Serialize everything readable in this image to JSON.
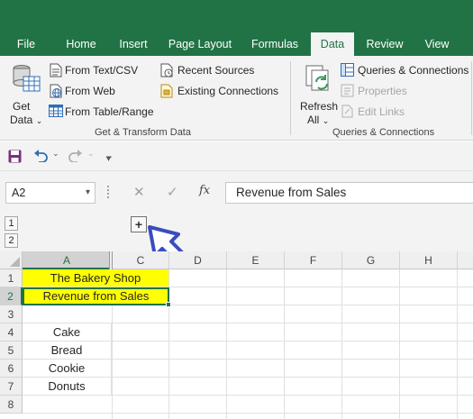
{
  "tabs": [
    {
      "label": "File",
      "active": false
    },
    {
      "label": "Home",
      "active": false
    },
    {
      "label": "Insert",
      "active": false
    },
    {
      "label": "Page Layout",
      "active": false
    },
    {
      "label": "Formulas",
      "active": false
    },
    {
      "label": "Data",
      "active": true
    },
    {
      "label": "Review",
      "active": false
    },
    {
      "label": "View",
      "active": false
    }
  ],
  "ribbon": {
    "get_data_label": "Get",
    "get_data_label2": "Data",
    "from_text_csv": "From Text/CSV",
    "from_web": "From Web",
    "from_table_range": "From Table/Range",
    "recent_sources": "Recent Sources",
    "existing_connections": "Existing Connections",
    "group1_label": "Get & Transform Data",
    "refresh_label": "Refresh",
    "refresh_label2": "All",
    "queries_connections": "Queries & Connections",
    "properties": "Properties",
    "edit_links": "Edit Links",
    "group2_label": "Queries & Connections"
  },
  "formula_bar": {
    "name_box": "A2",
    "fx": "fx",
    "value": "Revenue from Sales"
  },
  "outline": {
    "levels": [
      "1",
      "2"
    ],
    "expand_symbol": "+"
  },
  "sheet": {
    "columns": [
      "A",
      "C",
      "D",
      "E",
      "F",
      "G",
      "H"
    ],
    "rows": [
      "1",
      "2",
      "3",
      "4",
      "5",
      "6",
      "7",
      "8"
    ],
    "cells": {
      "r1": "The Bakery Shop",
      "r2": "Revenue from Sales",
      "r4": "Cake",
      "r5": "Bread",
      "r6": "Cookie",
      "r7": "Donuts"
    },
    "highlight_color": "#ffff00"
  },
  "colors": {
    "accent": "#217346",
    "arrow": "#3b4cc0"
  }
}
